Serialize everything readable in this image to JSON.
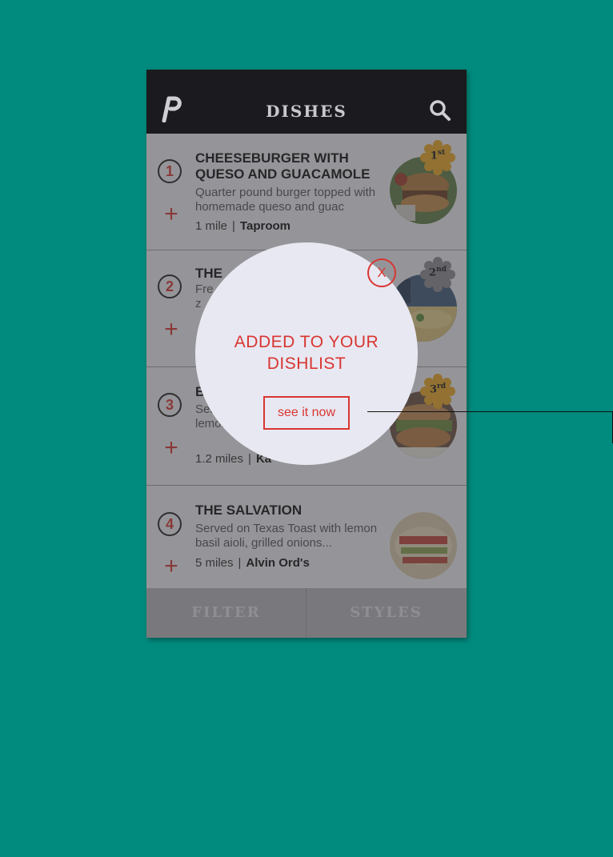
{
  "header": {
    "title": "DISHES"
  },
  "dishes": [
    {
      "rank": "1",
      "name": "CHEESEBURGER WITH QUESO AND GUACAMOLE",
      "description": "Quarter pound burger topped with homemade queso and guac",
      "distance": "1 mile",
      "sep": "|",
      "place": "Taproom",
      "badge": "1st",
      "badge_color": "#e8a625"
    },
    {
      "rank": "2",
      "name": "THE",
      "description": "Fre z",
      "distance": "",
      "sep": "",
      "place": "",
      "badge": "2nd",
      "badge_color": "#8d8d91"
    },
    {
      "rank": "3",
      "name": "BA",
      "description": "Serv lemon",
      "distance": "1.2 miles",
      "sep": "|",
      "place": "Ka",
      "badge": "3rd",
      "badge_color": "#e8a625"
    },
    {
      "rank": "4",
      "name": "THE SALVATION",
      "description": "Served on Texas Toast with lemon basil aioli, grilled onions...",
      "distance": "5 miles",
      "sep": "|",
      "place": "Alvin Ord's",
      "badge": "",
      "badge_color": ""
    }
  ],
  "plus_glyph": "+",
  "bottom_tabs": {
    "filter": "FILTER",
    "styles": "STYLES"
  },
  "popup": {
    "close": "X",
    "message": "ADDED TO YOUR DISHLIST",
    "action": "see it now"
  },
  "colors": {
    "background": "#008b7e",
    "accent": "#d93530",
    "header": "#1b1b1f"
  },
  "icons": {
    "logo": "logo-icon",
    "search": "search-icon",
    "add": "plus-icon",
    "close": "close-icon",
    "rank_badge": "rosette-icon"
  }
}
